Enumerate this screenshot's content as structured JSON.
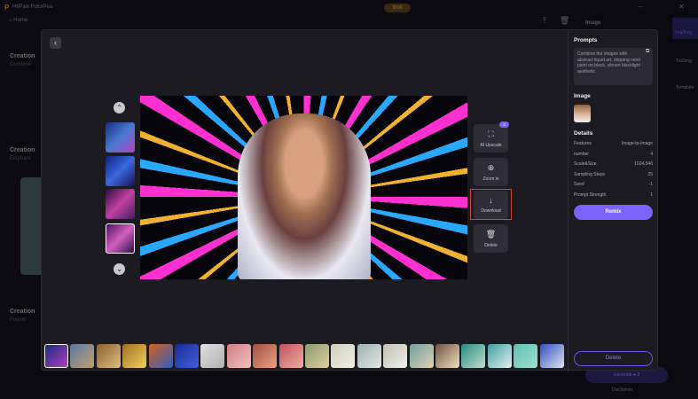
{
  "app": {
    "title": "HitPaw FotorPea",
    "home": "Home",
    "credits": "9596"
  },
  "background": {
    "items": [
      {
        "title": "Creation",
        "sub": "Combine"
      },
      {
        "title": "Creation",
        "sub": "Elephant"
      },
      {
        "title": "Creation",
        "sub": "Fusion"
      }
    ],
    "right_tabs": [
      "Img2img",
      "Txt2img",
      "Template"
    ],
    "header_label": "Image",
    "generate": "Generate",
    "generate_cost": "8",
    "disclaimer": "Disclaimer"
  },
  "viewer": {
    "actions": [
      {
        "label": "AI Upscale",
        "icon": "expand-icon",
        "badge": "2"
      },
      {
        "label": "Zoom in",
        "icon": "zoom-in-icon"
      },
      {
        "label": "Download",
        "icon": "download-icon",
        "highlighted": true
      },
      {
        "label": "Delete",
        "icon": "trash-icon"
      }
    ],
    "selected_thumb": 4,
    "strip_count": 20,
    "strip_selected": 1
  },
  "panel": {
    "prompts_title": "Prompts",
    "prompt": "Combine the images with abstract liquid art, dripping neon paint on black, vibrant blacklight aesthetic",
    "image_title": "Image",
    "details_title": "Details",
    "details": [
      {
        "k": "Features",
        "v": "Image-to-Image"
      },
      {
        "k": "number",
        "v": "4"
      },
      {
        "k": "Scale&Size",
        "v": "1024,546"
      },
      {
        "k": "Sampling Steps",
        "v": "25"
      },
      {
        "k": "Seed",
        "v": "-1"
      },
      {
        "k": "Prompt Strength",
        "v": "1"
      }
    ],
    "remix": "Remix",
    "delete": "Delete"
  },
  "colors": {
    "accent": "#7b61ff",
    "highlight": "#d0453a"
  }
}
